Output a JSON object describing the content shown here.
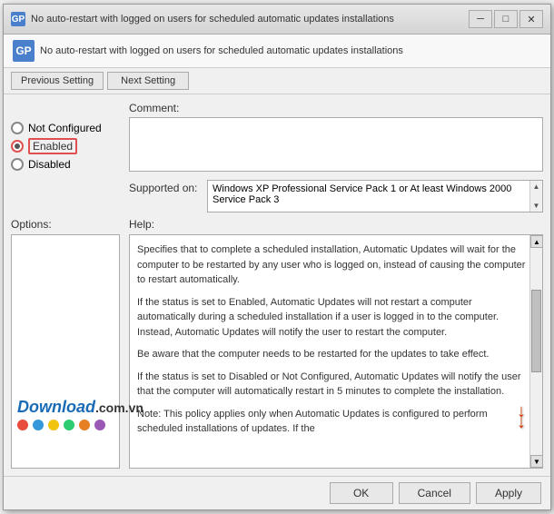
{
  "window": {
    "title": "No auto-restart with logged on users for scheduled automatic updates installations",
    "icon_label": "GP",
    "controls": {
      "minimize": "─",
      "maximize": "□",
      "close": "✕"
    }
  },
  "header": {
    "icon_label": "GP",
    "title": "No auto-restart with logged on users for scheduled automatic updates installations"
  },
  "toolbar": {
    "previous_label": "Previous Setting",
    "next_label": "Next Setting"
  },
  "radio": {
    "not_configured": "Not Configured",
    "enabled": "Enabled",
    "disabled": "Disabled"
  },
  "comment": {
    "label": "Comment:"
  },
  "supported": {
    "label": "Supported on:",
    "value": "Windows XP Professional Service Pack 1 or At least Windows 2000 Service Pack 3"
  },
  "panels": {
    "options_label": "Options:",
    "help_label": "Help:"
  },
  "help_text": {
    "p1": "Specifies that to complete a scheduled installation, Automatic Updates will wait for the computer to be restarted by any user who is logged on, instead of causing the computer to restart automatically.",
    "p2": "If the status is set to Enabled, Automatic Updates will not restart a computer automatically during a scheduled installation if a user is logged in to the computer. Instead, Automatic Updates will notify the user to restart the computer.",
    "p3": "Be aware that the computer needs to be restarted for the updates to take effect.",
    "p4": "If the status is set to Disabled or Not Configured, Automatic Updates will notify the user that the computer will automatically restart in 5 minutes to complete the installation.",
    "p5": "Note: This policy applies only when Automatic Updates is configured to perform scheduled installations of updates. If the"
  },
  "footer": {
    "ok_label": "OK",
    "cancel_label": "Cancel",
    "apply_label": "Apply"
  },
  "watermark": {
    "brand": "Download",
    "suffix": ".com.vn",
    "dots": [
      "#e74c3c",
      "#3498db",
      "#f1c40f",
      "#2ecc71",
      "#e67e22",
      "#9b59b6"
    ]
  }
}
